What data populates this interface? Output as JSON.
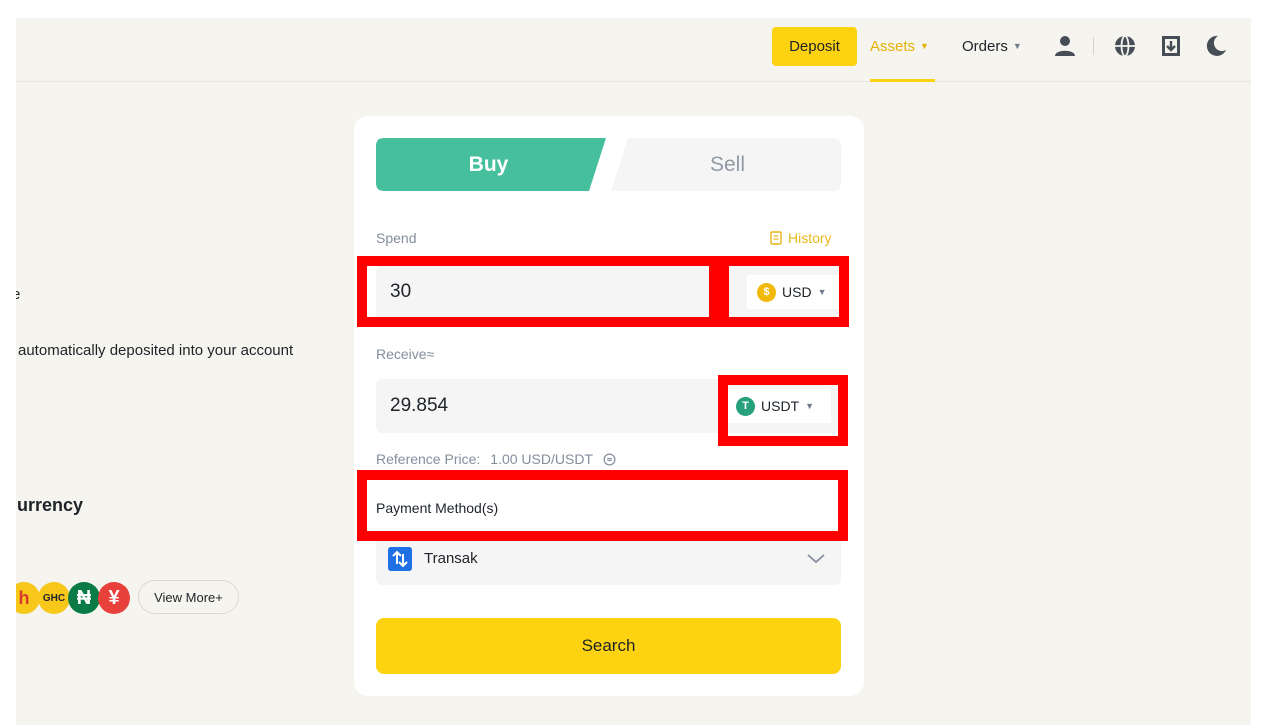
{
  "header": {
    "deposit_label": "Deposit",
    "assets_label": "Assets",
    "orders_label": "Orders",
    "icons": [
      "user-icon",
      "globe-icon",
      "download-icon",
      "moon-icon"
    ]
  },
  "left": {
    "partial_line": "e",
    "auto_deposit_text": "automatically deposited into your account",
    "currency_heading": "urrency",
    "coins": [
      {
        "symbol": "h",
        "color": "#f7c71a",
        "text_color": "#d83a2a"
      },
      {
        "symbol": "GHC",
        "color": "#f7c71a",
        "text_color": "#1e2329"
      },
      {
        "symbol": "₦",
        "color": "#0a7a46",
        "text_color": "#ffffff"
      },
      {
        "symbol": "¥",
        "color": "#e8403a",
        "text_color": "#ffffff"
      }
    ],
    "view_more_label": "View More+"
  },
  "card": {
    "tabs": {
      "buy": "Buy",
      "sell": "Sell",
      "active": "buy"
    },
    "spend": {
      "label": "Spend",
      "history_label": "History",
      "value": "30",
      "currency": "USD",
      "currency_icon_color": "#f0b90b",
      "currency_icon_glyph": "$"
    },
    "receive": {
      "label": "Receive≈",
      "value": "29.854",
      "currency": "USDT",
      "currency_icon_color": "#26a17b",
      "currency_icon_glyph": "T"
    },
    "reference_price": {
      "label": "Reference Price:",
      "value": "1.00 USD/USDT"
    },
    "payment": {
      "label": "Payment Method(s)",
      "provider": "Transak"
    },
    "search_label": "Search"
  },
  "colors": {
    "accent_yellow": "#fcd211",
    "buy_green": "#46bf9c",
    "highlight_red": "#ff0000",
    "page_bg": "#f5f4ee"
  }
}
